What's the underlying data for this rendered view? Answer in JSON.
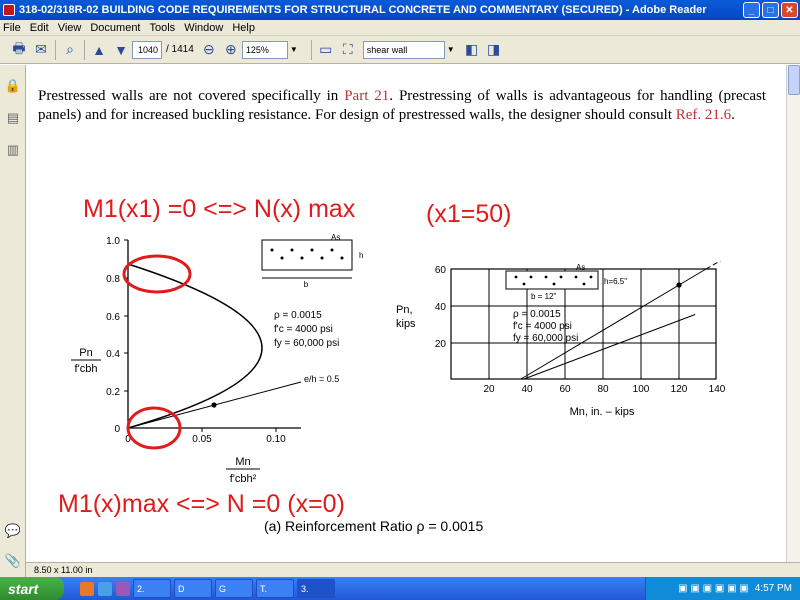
{
  "window": {
    "title": "318-02/318R-02 BUILDING CODE REQUIREMENTS FOR STRUCTURAL CONCRETE AND COMMENTARY (SECURED) - Adobe Reader",
    "controls": {
      "minimize": "_",
      "maximize": "□",
      "close": "✕"
    }
  },
  "menu": [
    "File",
    "Edit",
    "View",
    "Document",
    "Tools",
    "Window",
    "Help"
  ],
  "toolbar": {
    "page_current": "1040",
    "page_total": "/ 1414",
    "zoom": "125%",
    "search_value": "shear wall"
  },
  "document": {
    "para_1": "Prestressed walls are not covered specifically in ",
    "para_link_1": "Part 21",
    "para_2": ".  Prestressing of walls is advantageous for handling (precast panels) and for increased buckling resistance.  For design of prestressed walls, the designer should consult ",
    "para_link_2": "Ref. 21.6",
    "para_3": ".",
    "annotations": {
      "top": "M1(x1) =0  <=>  N(x) max",
      "x1": "(x1=50)",
      "bottom": "M1(x)max <=> N =0 (x=0)"
    },
    "caption": "(a) Reinforcement Ratio ρ = 0.0015"
  },
  "figure_left": {
    "y_ticks": [
      "1.0",
      "0.8",
      "0.6",
      "0.4",
      "0.2",
      "0"
    ],
    "x_ticks": [
      "0",
      "0.05",
      "0.10"
    ],
    "ylabel_num": "Pn",
    "ylabel_den": "f'cbh",
    "xlabel_num": "Mn",
    "xlabel_den": "f'cbh²",
    "eh_label": "e/h = 0.5",
    "params": [
      "ρ      = 0.0015",
      "f'c   = 4000 psi",
      "fy    = 60,000 psi"
    ],
    "section_labels": {
      "as": "As",
      "h": "h",
      "b": "b"
    }
  },
  "figure_right": {
    "y_ticks": [
      "60",
      "40",
      "20"
    ],
    "x_ticks": [
      "20",
      "40",
      "60",
      "80",
      "100",
      "120",
      "140"
    ],
    "ylabel": "Pn,",
    "ylabel2": "kips",
    "xlabel": "Mn, in. – kips",
    "params": [
      "ρ    = 0.0015",
      "f'c  = 4000 psi",
      "fy   = 60,000 psi"
    ],
    "section_labels": {
      "as": "As",
      "h": "h=6.5\"",
      "b": "b = 12\""
    }
  },
  "statusbar": {
    "page_size": "8.50 x 11.00 in"
  },
  "taskbar": {
    "start": "start",
    "tasks": [
      "2.",
      "D",
      "G",
      "T.",
      "3."
    ],
    "clock": "4:57 PM"
  },
  "colors": {
    "annotation": "#e01b1b",
    "link": "#c03035",
    "titlebar": "#0a5bd8"
  }
}
